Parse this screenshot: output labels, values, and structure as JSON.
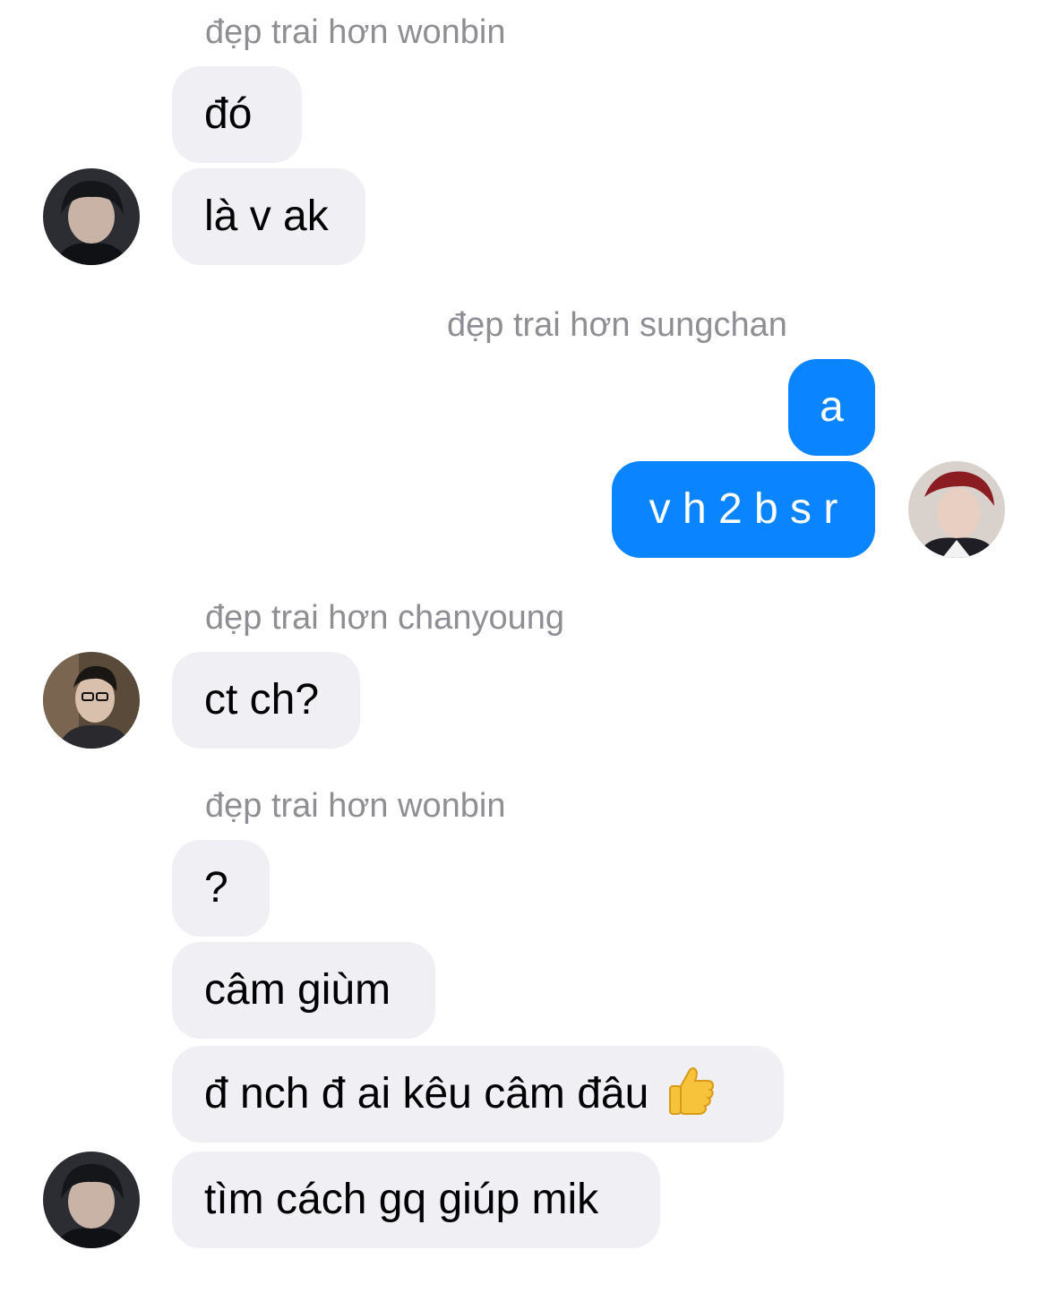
{
  "messages": {
    "group1": {
      "sender": "đẹp trai hơn wonbin",
      "bubbles": [
        "đó",
        "là v ak"
      ]
    },
    "group2": {
      "sender": "đẹp trai hơn sungchan",
      "bubbles": [
        "a",
        "v h 2 b s r"
      ]
    },
    "group3": {
      "sender": "đẹp trai hơn chanyoung",
      "bubbles": [
        "ct ch?"
      ]
    },
    "group4": {
      "sender": "đẹp trai hơn wonbin",
      "bubbles": [
        "?",
        "câm giùm",
        "đ nch đ ai kêu câm đâu",
        "tìm cách gq giúp mik"
      ]
    }
  },
  "icons": {
    "emoji": "thumbs-up-icon",
    "avatar_wonbin": "avatar-wonbin",
    "avatar_sungchan": "avatar-sungchan",
    "avatar_chanyoung": "avatar-chanyoung"
  },
  "colors": {
    "incoming_bubble": "#efeff4",
    "outgoing_bubble": "#0a84ff",
    "sender_name": "#8e8e93"
  }
}
